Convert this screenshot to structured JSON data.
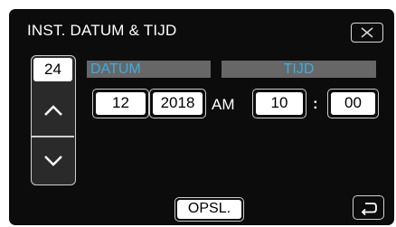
{
  "window": {
    "title": "INST. DATUM & TIJD"
  },
  "headers": {
    "datum": "DATUM",
    "tijd": "TIJD"
  },
  "stepper": {
    "value": "24"
  },
  "date": {
    "month": "12",
    "year": "2018"
  },
  "time": {
    "ampm": "AM",
    "hour": "10",
    "separator": ":",
    "minute": "00"
  },
  "actions": {
    "save_label": "OPSL."
  },
  "colors": {
    "screen_bg": "#0c0c0c",
    "header_bar": "#676767",
    "header_text": "#38aee6"
  },
  "icons": {
    "close": "close-icon",
    "up": "chevron-up-icon",
    "down": "chevron-down-icon",
    "back": "return-icon"
  }
}
